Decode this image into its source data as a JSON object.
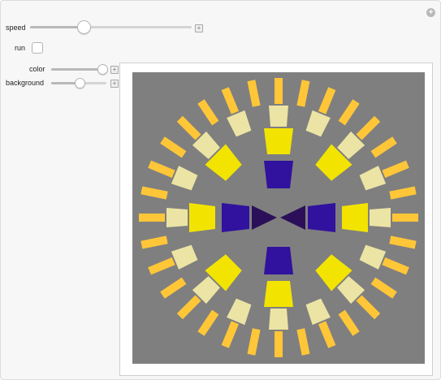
{
  "controls": {
    "speed": {
      "label": "speed",
      "value": 0.33
    },
    "run": {
      "label": "run",
      "checked": false
    },
    "color": {
      "label": "color",
      "value": 0.96
    },
    "background": {
      "label": "background",
      "value": 0.5
    }
  },
  "graphic": {
    "background_color": "#7f7f7f",
    "rings": [
      {
        "count": 32,
        "r1": 140,
        "r2": 172,
        "w1": 10,
        "w2": 10,
        "color": "#ffc638"
      },
      {
        "count": 16,
        "r1": 112,
        "r2": 138,
        "w1": 20,
        "w2": 24,
        "color": "#ece4a4"
      },
      {
        "count": 8,
        "r1": 78,
        "r2": 110,
        "w1": 28,
        "w2": 36,
        "color": "#f2e400"
      },
      {
        "count": 4,
        "r1": 36,
        "r2": 70,
        "w1": 28,
        "w2": 36,
        "color": "#30129e"
      }
    ],
    "center_wedge_color": "#2b1059"
  },
  "icons": {
    "corner": "plus-circle-icon",
    "slider_plus": "plus-square-icon"
  }
}
